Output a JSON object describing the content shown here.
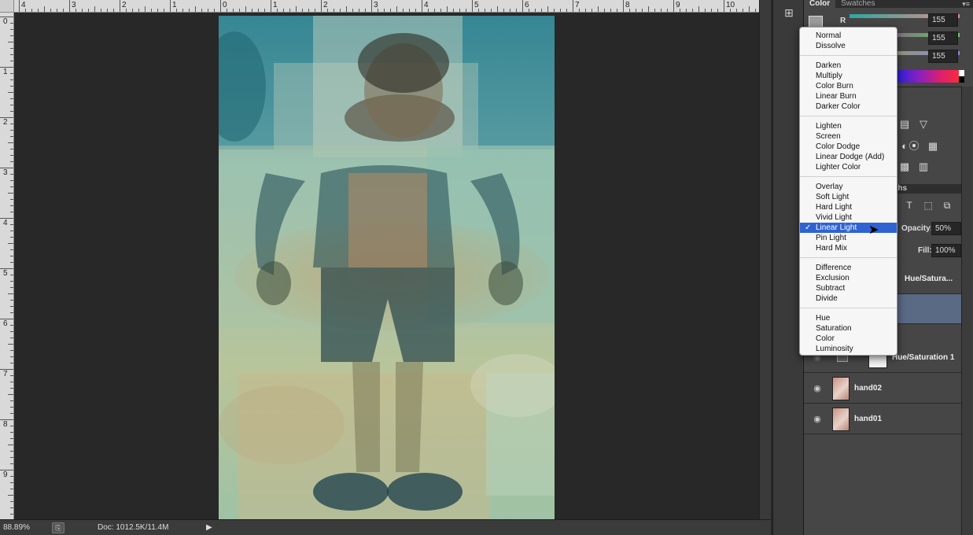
{
  "ruler": {
    "top_labels": [
      "4",
      "3",
      "2",
      "1",
      "0",
      "1",
      "2",
      "3",
      "4",
      "5",
      "6",
      "7",
      "8",
      "9",
      "10"
    ],
    "left_labels": [
      "0",
      "1",
      "2",
      "3",
      "4",
      "5",
      "6",
      "7",
      "8",
      "9"
    ]
  },
  "status": {
    "zoom": "88.89%",
    "doc": "Doc: 1012.5K/11.4M",
    "arrow": "▶"
  },
  "color_panel": {
    "tabs": [
      "Color",
      "Swatches"
    ],
    "channels": [
      {
        "label": "R",
        "value": "155"
      },
      {
        "label": "",
        "value": "155"
      },
      {
        "label": "",
        "value": "155"
      }
    ],
    "colors": {
      "foreground": "#9b9b9b"
    }
  },
  "layers_panel": {
    "tab_fragment": "ths",
    "opacity_label": "Opacity:",
    "opacity_value": "50%",
    "fill_label": "Fill:",
    "fill_value": "100%",
    "layers": [
      {
        "name": "Hue/Satura...",
        "kind": "adjustment",
        "visible": false,
        "selected": false
      },
      {
        "name": "",
        "kind": "image",
        "visible": false,
        "selected": true
      },
      {
        "name": "Hue/Saturation 1",
        "kind": "adjustment",
        "visible": false,
        "selected": false
      },
      {
        "name": "hand02",
        "kind": "image",
        "visible": true,
        "selected": false
      },
      {
        "name": "hand01",
        "kind": "image",
        "visible": true,
        "selected": false
      }
    ]
  },
  "blend_menu": {
    "selected": "Linear Light",
    "groups": [
      [
        "Normal",
        "Dissolve"
      ],
      [
        "Darken",
        "Multiply",
        "Color Burn",
        "Linear Burn",
        "Darker Color"
      ],
      [
        "Lighten",
        "Screen",
        "Color Dodge",
        "Linear Dodge (Add)",
        "Lighter Color"
      ],
      [
        "Overlay",
        "Soft Light",
        "Hard Light",
        "Vivid Light",
        "Linear Light",
        "Pin Light",
        "Hard Mix"
      ],
      [
        "Difference",
        "Exclusion",
        "Subtract",
        "Divide"
      ],
      [
        "Hue",
        "Saturation",
        "Color",
        "Luminosity"
      ]
    ]
  },
  "icons": {
    "checkmark": "✓",
    "eye": "👁",
    "menu": "▾≡",
    "dropdown": "▾"
  }
}
